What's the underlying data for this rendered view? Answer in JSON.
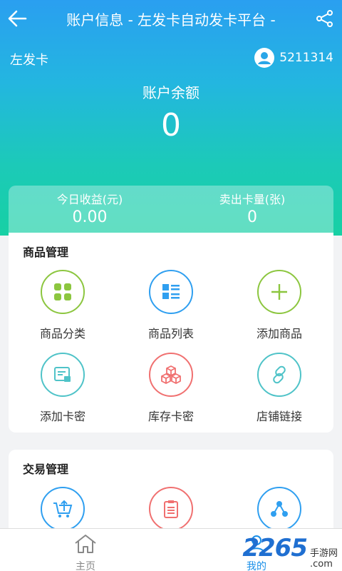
{
  "header": {
    "title": "账户信息 - 左发卡自动发卡平台 -"
  },
  "account": {
    "brand": "左发卡",
    "user_id": "5211314",
    "balance_label": "账户余额",
    "balance_value": "0"
  },
  "stats": [
    {
      "label": "今日收益(元)",
      "value": "0.00"
    },
    {
      "label": "卖出卡量(张)",
      "value": "0"
    }
  ],
  "goods": {
    "title": "商品管理",
    "items": [
      {
        "label": "商品分类",
        "icon": "grid-icon",
        "color": "#8cc63f"
      },
      {
        "label": "商品列表",
        "icon": "list-icon",
        "color": "#2f9ff0"
      },
      {
        "label": "添加商品",
        "icon": "plus-icon",
        "color": "#8cc63f"
      },
      {
        "label": "添加卡密",
        "icon": "card-key-icon",
        "color": "#4fc3c8"
      },
      {
        "label": "库存卡密",
        "icon": "boxes-icon",
        "color": "#f07070"
      },
      {
        "label": "店铺链接",
        "icon": "link-icon",
        "color": "#4fc3c8"
      }
    ]
  },
  "trade": {
    "title": "交易管理",
    "items": [
      {
        "icon": "cart-upload-icon",
        "color": "#2f9ff0"
      },
      {
        "icon": "clipboard-icon",
        "color": "#f07070"
      },
      {
        "icon": "network-icon",
        "color": "#2f9ff0"
      }
    ]
  },
  "tabbar": {
    "home_label": "主页",
    "mine_label": "我的"
  },
  "watermark": {
    "number": "2265",
    "suffix": "手游网",
    "url": ".com"
  }
}
